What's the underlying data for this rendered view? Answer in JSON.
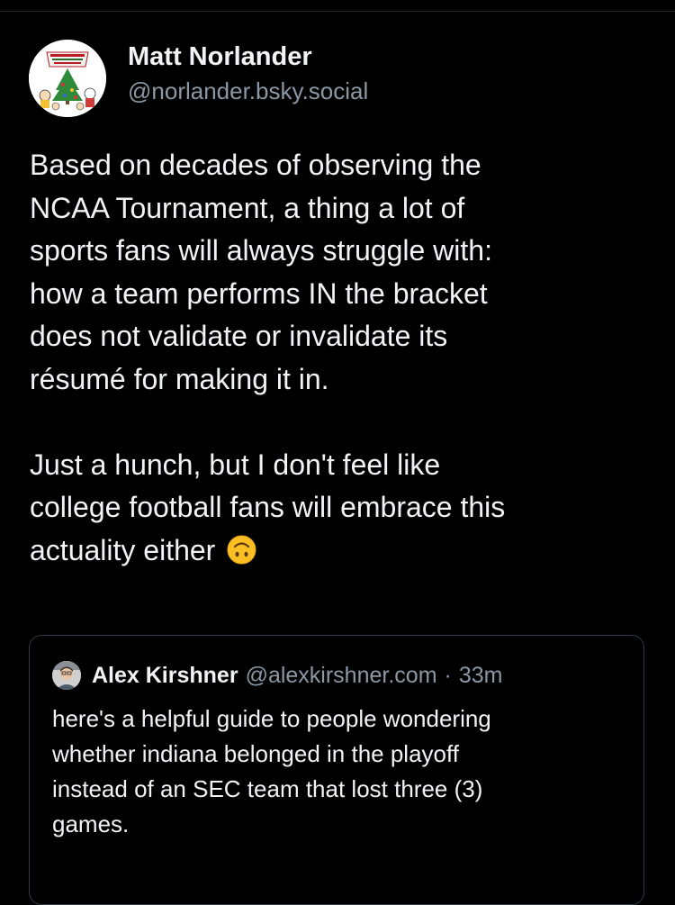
{
  "post": {
    "author": {
      "display_name": "Matt Norlander",
      "handle": "@norlander.bsky.social",
      "avatar_icon": "charlie-brown-christmas-avatar"
    },
    "text": {
      "paragraph_1_lines": [
        "Based on decades of observing the",
        "NCAA Tournament, a thing a lot of",
        "sports fans will always struggle with:",
        "how a team performs IN the bracket",
        "does not validate or invalidate its",
        "résumé for making it in."
      ],
      "paragraph_2_lines": [
        "Just a hunch, but I don't feel like",
        "college football fans will embrace this",
        "actuality either"
      ],
      "emoji": "upside-down-face"
    }
  },
  "quote": {
    "author": {
      "display_name": "Alex Kirshner",
      "handle": "@alexkirshner.com",
      "separator": "·",
      "time": "33m",
      "avatar_icon": "user-avatar"
    },
    "text_lines": [
      "here's a helpful guide to people wondering",
      "whether indiana belonged in the playoff",
      "instead of an SEC team that lost three (3)",
      "games."
    ]
  },
  "colors": {
    "background": "#000000",
    "primary_text": "#f1f3f5",
    "secondary_text": "#8b98a5",
    "quote_border": "#2e3a47",
    "emoji_yellow": "#fbbf24"
  }
}
